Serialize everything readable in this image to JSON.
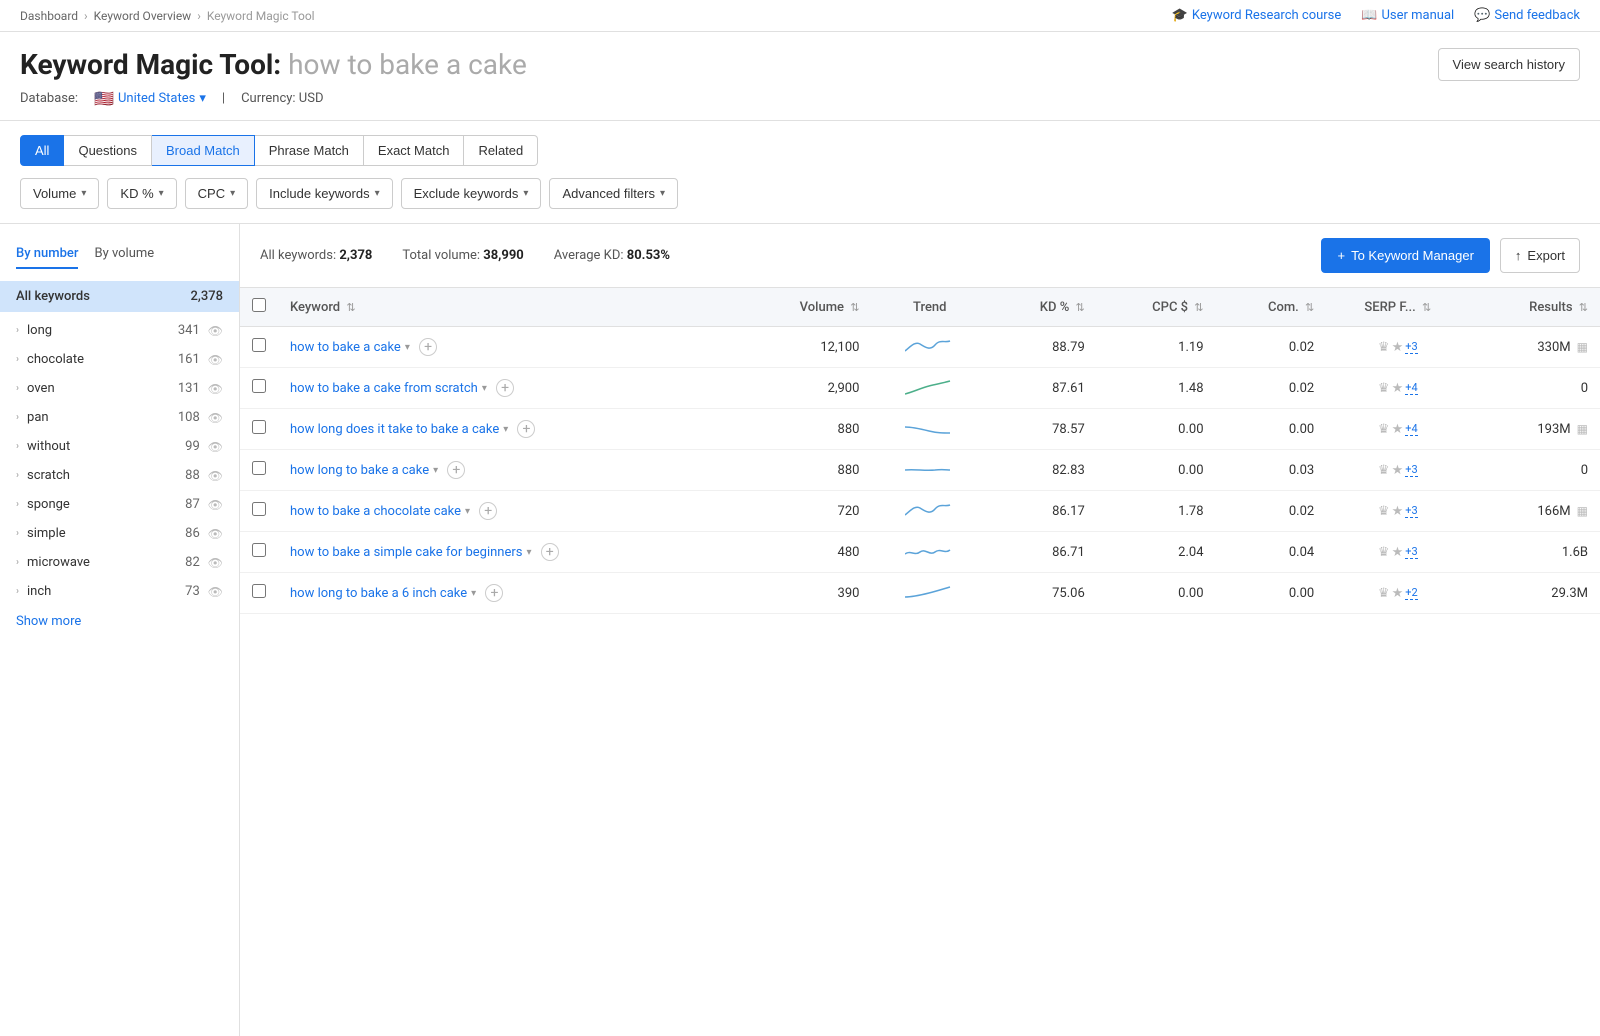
{
  "breadcrumb": {
    "items": [
      "Dashboard",
      "Keyword Overview",
      "Keyword Magic Tool"
    ]
  },
  "top_links": [
    {
      "label": "Keyword Research course",
      "icon": "🎓"
    },
    {
      "label": "User manual",
      "icon": "📖"
    },
    {
      "label": "Send feedback",
      "icon": "💬"
    }
  ],
  "header": {
    "title": "Keyword Magic Tool:",
    "query": " how to bake a cake",
    "database_label": "Database:",
    "database_value": "United States",
    "currency": "Currency: USD",
    "view_history": "View search history"
  },
  "match_tabs": [
    {
      "label": "All",
      "active": true
    },
    {
      "label": "Questions",
      "active": false
    },
    {
      "label": "Broad Match",
      "active_outline": true
    },
    {
      "label": "Phrase Match",
      "active": false
    },
    {
      "label": "Exact Match",
      "active": false
    },
    {
      "label": "Related",
      "active": false
    }
  ],
  "filter_buttons": [
    {
      "label": "Volume"
    },
    {
      "label": "KD %"
    },
    {
      "label": "CPC"
    },
    {
      "label": "Include keywords"
    },
    {
      "label": "Exclude keywords"
    },
    {
      "label": "Advanced filters"
    }
  ],
  "sidebar": {
    "tabs": [
      {
        "label": "By number",
        "active": true
      },
      {
        "label": "By volume",
        "active": false
      }
    ],
    "all_keywords": {
      "label": "All keywords",
      "count": "2,378"
    },
    "items": [
      {
        "label": "long",
        "count": "341"
      },
      {
        "label": "chocolate",
        "count": "161"
      },
      {
        "label": "oven",
        "count": "131"
      },
      {
        "label": "pan",
        "count": "108"
      },
      {
        "label": "without",
        "count": "99"
      },
      {
        "label": "scratch",
        "count": "88"
      },
      {
        "label": "sponge",
        "count": "87"
      },
      {
        "label": "simple",
        "count": "86"
      },
      {
        "label": "microwave",
        "count": "82"
      },
      {
        "label": "inch",
        "count": "73"
      }
    ],
    "show_more": "Show more"
  },
  "summary": {
    "all_keywords_label": "All keywords:",
    "all_keywords_value": "2,378",
    "total_volume_label": "Total volume:",
    "total_volume_value": "38,990",
    "avg_kd_label": "Average KD:",
    "avg_kd_value": "80.53%"
  },
  "actions": {
    "to_keyword_manager": "+ To Keyword Manager",
    "export": "Export"
  },
  "table": {
    "columns": [
      "",
      "Keyword",
      "Volume",
      "Trend",
      "KD %",
      "CPC $",
      "Com.",
      "SERP F...",
      "Results"
    ],
    "rows": [
      {
        "keyword": "how to bake a cake",
        "volume": "12,100",
        "kd": "88.79",
        "cpc": "1.19",
        "com": "0.02",
        "results": "330M",
        "serp_extras": "+3",
        "has_results_icon": true,
        "trend": "up-down"
      },
      {
        "keyword": "how to bake a cake from scratch",
        "volume": "2,900",
        "kd": "87.61",
        "cpc": "1.48",
        "com": "0.02",
        "results": "0",
        "serp_extras": "+4",
        "has_results_icon": false,
        "trend": "up"
      },
      {
        "keyword": "how long does it take to bake a cake",
        "volume": "880",
        "kd": "78.57",
        "cpc": "0.00",
        "com": "0.00",
        "results": "193M",
        "serp_extras": "+4",
        "has_results_icon": true,
        "trend": "flat-down"
      },
      {
        "keyword": "how long to bake a cake",
        "volume": "880",
        "kd": "82.83",
        "cpc": "0.00",
        "com": "0.03",
        "results": "0",
        "serp_extras": "+3",
        "has_results_icon": false,
        "trend": "flat"
      },
      {
        "keyword": "how to bake a chocolate cake",
        "volume": "720",
        "kd": "86.17",
        "cpc": "1.78",
        "com": "0.02",
        "results": "166M",
        "serp_extras": "+3",
        "has_results_icon": true,
        "trend": "up-down"
      },
      {
        "keyword": "how to bake a simple cake for beginners",
        "volume": "480",
        "kd": "86.71",
        "cpc": "2.04",
        "com": "0.04",
        "results": "1.6B",
        "serp_extras": "+3",
        "has_results_icon": false,
        "trend": "wavy"
      },
      {
        "keyword": "how long to bake a 6 inch cake",
        "volume": "390",
        "kd": "75.06",
        "cpc": "0.00",
        "com": "0.00",
        "results": "29.3M",
        "serp_extras": "+2",
        "has_results_icon": false,
        "trend": "flat-up"
      }
    ]
  }
}
